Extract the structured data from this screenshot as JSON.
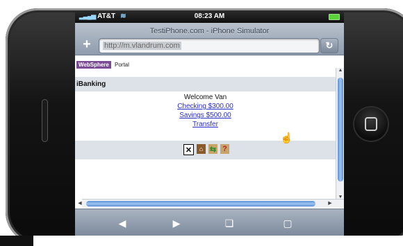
{
  "status": {
    "carrier": "AT&T",
    "time": "08:23 AM"
  },
  "browser": {
    "title": "TestiPhone.com - iPhone Simulator",
    "url": "http://m.vlandrum.com"
  },
  "portal": {
    "badge": "WebSphere",
    "text": "Portal"
  },
  "section": {
    "title": "iBanking"
  },
  "account": {
    "welcome": "Welcome Van",
    "links": [
      "Checking $300.00",
      "Savings $500.00",
      "Transfer"
    ]
  },
  "icons": [
    "close-icon",
    "home-icon",
    "switch-icon",
    "help-icon"
  ],
  "colors": {
    "badge": "#7a4c93",
    "link": "#2a2cc9",
    "section_bg": "#dde2e9"
  }
}
